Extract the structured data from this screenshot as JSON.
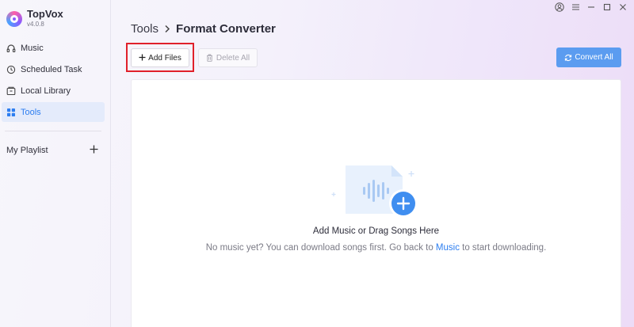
{
  "app": {
    "name": "TopVox",
    "version": "v4.0.8"
  },
  "sidebar": {
    "items": [
      {
        "label": "Music",
        "icon": "headphones-icon"
      },
      {
        "label": "Scheduled Task",
        "icon": "clock-icon"
      },
      {
        "label": "Local Library",
        "icon": "library-icon"
      },
      {
        "label": "Tools",
        "icon": "grid-icon",
        "active": true
      }
    ],
    "playlist_label": "My Playlist"
  },
  "header": {
    "crumb": "Tools",
    "current": "Format Converter"
  },
  "toolbar": {
    "add_files_label": "Add Files",
    "delete_all_label": "Delete All",
    "convert_all_label": "Convert All"
  },
  "empty": {
    "title": "Add Music or Drag Songs Here",
    "sub_before": "No music yet? You can download songs first. Go back to ",
    "sub_link": "Music",
    "sub_after": " to start downloading."
  },
  "colors": {
    "accent": "#2d7ef0",
    "convert_button": "#5b9cf0",
    "highlight": "#e0202a"
  }
}
